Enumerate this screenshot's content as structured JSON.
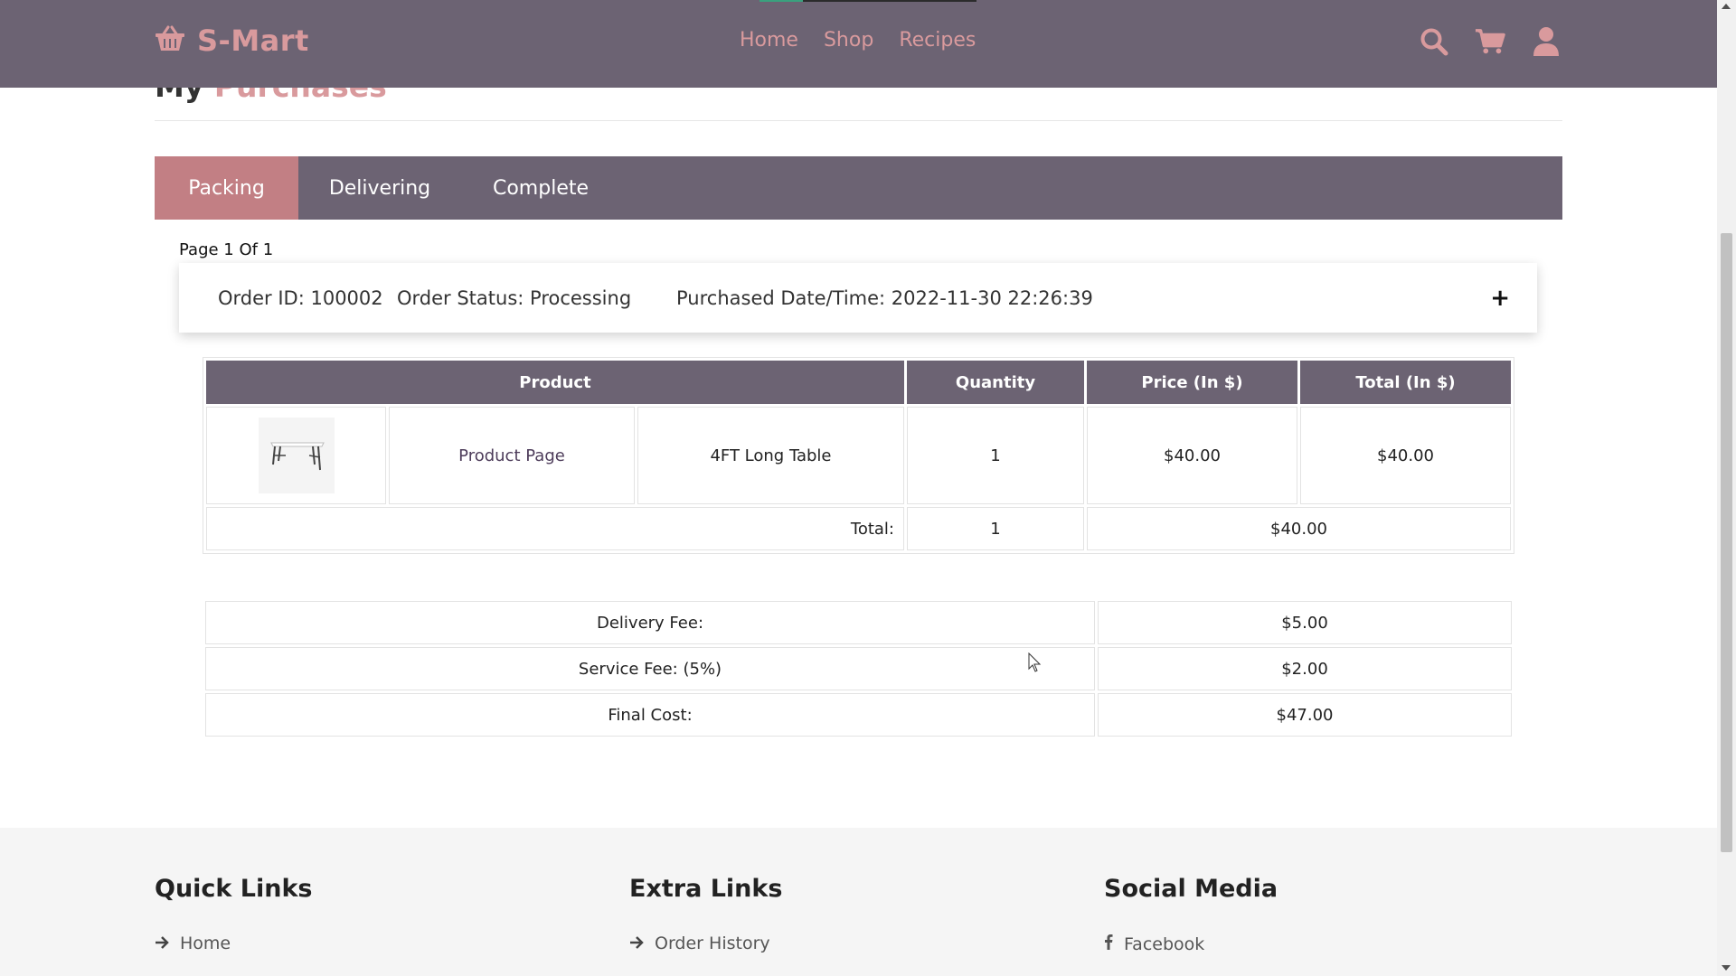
{
  "header": {
    "brand": "S-Mart",
    "nav": [
      {
        "label": "Home"
      },
      {
        "label": "Shop"
      },
      {
        "label": "Recipes"
      }
    ],
    "icons": [
      "search-icon",
      "cart-icon",
      "user-icon"
    ]
  },
  "page": {
    "title_main": "My",
    "title_accent": "Purchases"
  },
  "tabs": [
    {
      "label": "Packing",
      "active": true
    },
    {
      "label": "Delivering",
      "active": false
    },
    {
      "label": "Complete",
      "active": false
    }
  ],
  "page_count": "Page 1 Of 1",
  "order": {
    "id_text": "Order ID: 100002",
    "status_text": "Order Status: Processing",
    "date_text": "Purchased Date/Time: 2022-11-30 22:26:39",
    "toggle": "+"
  },
  "items_table": {
    "headers": {
      "product": "Product",
      "quantity": "Quantity",
      "price": "Price (In $)",
      "total": "Total (In $)"
    },
    "rows": [
      {
        "link": "Product Page",
        "name": "4FT Long Table",
        "quantity": "1",
        "price": "$40.00",
        "total": "$40.00"
      }
    ],
    "total_label": "Total:",
    "total_quantity": "1",
    "total_amount": "$40.00"
  },
  "fees": {
    "delivery_label": "Delivery Fee:",
    "delivery_value": "$5.00",
    "service_label": "Service Fee: (5%)",
    "service_value": "$2.00",
    "final_label": "Final Cost:",
    "final_value": "$47.00"
  },
  "footer": {
    "quick_links": {
      "title": "Quick Links",
      "first": "Home"
    },
    "extra_links": {
      "title": "Extra Links",
      "first": "Order History"
    },
    "social": {
      "title": "Social Media",
      "first": "Facebook"
    }
  },
  "colors": {
    "header_bg": "#6c6373",
    "accent": "#d99a9d",
    "active_tab": "#c27f84"
  }
}
